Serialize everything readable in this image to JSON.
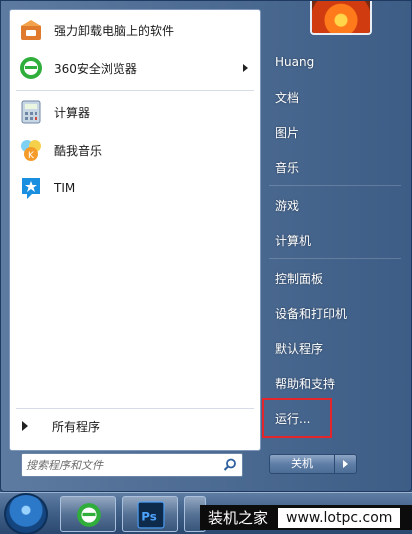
{
  "programs": [
    {
      "label": "强力卸载电脑上的软件",
      "icon": "uninstall-box-icon",
      "has_submenu": false
    },
    {
      "label": "360安全浏览器",
      "icon": "360-browser-icon",
      "has_submenu": true
    },
    {
      "label": "计算器",
      "icon": "calculator-icon",
      "has_submenu": false
    },
    {
      "label": "酷我音乐",
      "icon": "kuwo-music-icon",
      "has_submenu": false
    },
    {
      "label": "TIM",
      "icon": "tim-icon",
      "has_submenu": false
    }
  ],
  "all_programs": "所有程序",
  "search": {
    "placeholder": "搜索程序和文件"
  },
  "right_pane": {
    "user": "Huang",
    "items": [
      "文档",
      "图片",
      "音乐",
      "游戏",
      "计算机",
      "控制面板",
      "设备和打印机",
      "默认程序",
      "帮助和支持",
      "运行..."
    ]
  },
  "shutdown_label": "关机",
  "taskbar": {
    "apps": [
      "360-browser-icon",
      "photoshop-icon"
    ]
  },
  "watermark": {
    "cn": "装机之家",
    "url": "www.lotpc.com"
  },
  "colors": {
    "highlight": "#e3262b",
    "menu_blue": "#3d5d86"
  }
}
